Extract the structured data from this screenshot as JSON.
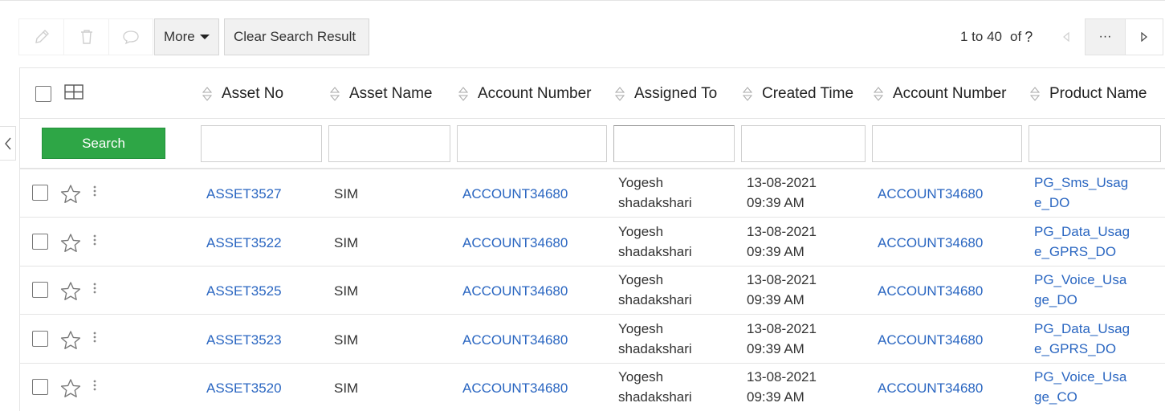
{
  "toolbar": {
    "edit_icon": "pencil-icon",
    "delete_icon": "trash-icon",
    "comment_icon": "comment-icon",
    "more_label": "More",
    "clear_label": "Clear Search Result"
  },
  "pager": {
    "range_text": "1 to 40",
    "of_text": "of",
    "total_text": "?",
    "more_label": "···"
  },
  "table": {
    "search_label": "Search",
    "columns": [
      "Asset No",
      "Asset Name",
      "Account Number",
      "Assigned To",
      "Created Time",
      "Account Number",
      "Product Name"
    ],
    "rows": [
      {
        "asset_no": "ASSET3527",
        "asset_name": "SIM",
        "account_number": "ACCOUNT34680",
        "assigned_to_1": "Yogesh",
        "assigned_to_2": "shadakshari",
        "created_date": "13-08-2021",
        "created_time": "09:39 AM",
        "account_number_2": "ACCOUNT34680",
        "product_1": "PG_Sms_Usag",
        "product_2": "e_DO"
      },
      {
        "asset_no": "ASSET3522",
        "asset_name": "SIM",
        "account_number": "ACCOUNT34680",
        "assigned_to_1": "Yogesh",
        "assigned_to_2": "shadakshari",
        "created_date": "13-08-2021",
        "created_time": "09:39 AM",
        "account_number_2": "ACCOUNT34680",
        "product_1": "PG_Data_Usag",
        "product_2": "e_GPRS_DO"
      },
      {
        "asset_no": "ASSET3525",
        "asset_name": "SIM",
        "account_number": "ACCOUNT34680",
        "assigned_to_1": "Yogesh",
        "assigned_to_2": "shadakshari",
        "created_date": "13-08-2021",
        "created_time": "09:39 AM",
        "account_number_2": "ACCOUNT34680",
        "product_1": "PG_Voice_Usa",
        "product_2": "ge_DO"
      },
      {
        "asset_no": "ASSET3523",
        "asset_name": "SIM",
        "account_number": "ACCOUNT34680",
        "assigned_to_1": "Yogesh",
        "assigned_to_2": "shadakshari",
        "created_date": "13-08-2021",
        "created_time": "09:39 AM",
        "account_number_2": "ACCOUNT34680",
        "product_1": "PG_Data_Usag",
        "product_2": "e_GPRS_DO"
      },
      {
        "asset_no": "ASSET3520",
        "asset_name": "SIM",
        "account_number": "ACCOUNT34680",
        "assigned_to_1": "Yogesh",
        "assigned_to_2": "shadakshari",
        "created_date": "13-08-2021",
        "created_time": "09:39 AM",
        "account_number_2": "ACCOUNT34680",
        "product_1": "PG_Voice_Usa",
        "product_2": "ge_CO"
      }
    ]
  },
  "colors": {
    "link": "#2a66c1",
    "search_button": "#2ea646"
  }
}
